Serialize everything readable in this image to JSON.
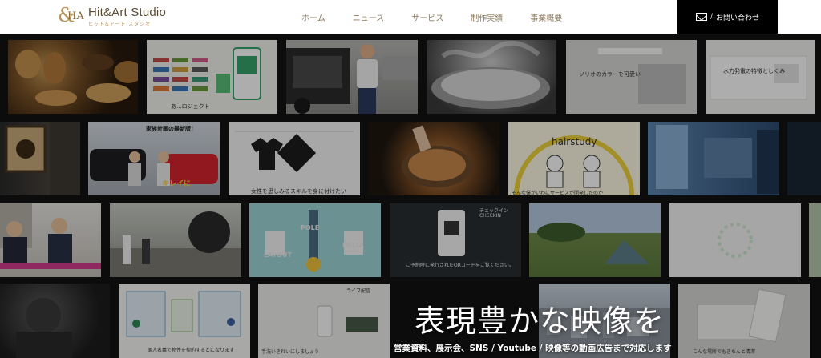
{
  "brand": {
    "name": "Hit&Art Studio",
    "tagline": "ヒット&アート スタジオ",
    "monogram": "&HA"
  },
  "nav": {
    "items": [
      {
        "label": "ホーム"
      },
      {
        "label": "ニュース"
      },
      {
        "label": "サービス"
      },
      {
        "label": "制作実績"
      },
      {
        "label": "事業概要"
      }
    ]
  },
  "contact": {
    "label": "お問い合わせ",
    "slash": "/",
    "icon": "envelope-icon"
  },
  "tiles": {
    "t3_text": "あ...ロジェクト",
    "ev_caption": "ソリオのカラーを可愛い",
    "tv_text": "水力発電の特徴としくみ",
    "family_headline": "家族計画の最新版！",
    "car_caption": "キレイに",
    "tshirt_caption": "女性を思しみるスキルを身に付けたい",
    "hairstudy_title": "hairstudy",
    "hairstudy_caption": "そんな僕がいわにサービスが開発したのか",
    "pole_left": "POLE",
    "pole_right": "DELTA",
    "pole_bottom": "LAYOUT",
    "checkin_title": "チェックイン",
    "checkin_en": "CHECKIN",
    "checkin_caption": "ご予約時に発行されたQRコードをご覧ください。",
    "live_caption": "ライブ配信",
    "plan_caption": "個人名義で物件を契約するとになります",
    "handwash_caption": "手洗いきれいにしましょう",
    "towel_caption": "こんな場所でもきちんと清潔"
  },
  "hero": {
    "headline": "表現豊かな映像を",
    "subline": "営業資料、展示会、SNS / Youtube / 映像等の動画広告まで対応します"
  }
}
